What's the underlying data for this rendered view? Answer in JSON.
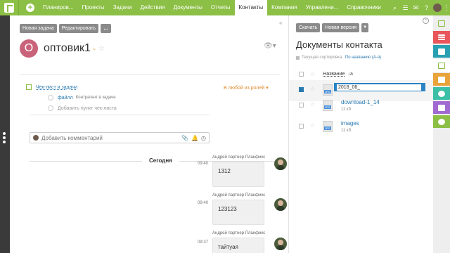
{
  "topbar": {
    "nav": [
      "Планиров...",
      "Проекты",
      "Задачи",
      "Действия",
      "Документы",
      "Отчеты",
      "Контакты",
      "Компания",
      "Управлени...",
      "Справочники"
    ],
    "active_index": 6
  },
  "toolbar": {
    "new_task": "Новая задача",
    "edit": "Редактировать",
    "more": "..."
  },
  "contact": {
    "initial": "О",
    "name": "оптовик1",
    "dash": "-"
  },
  "checklist": {
    "title": "Чек-лист и задачи",
    "roles": "В любой из ролей ▾",
    "item_link": "файлл",
    "item_sub": "Контрагент в задаче",
    "add_item": "Добавить пункт чек-листа"
  },
  "comment": {
    "placeholder": "Добавить комментарий"
  },
  "timeline": {
    "today": "Сегодня",
    "messages": [
      {
        "author": "Андрей партнер Планфикс",
        "time": "09:40",
        "text": "1312"
      },
      {
        "author": "Андрей партнер Планфикс",
        "time": "09:40",
        "text": "123123"
      },
      {
        "author": "Андрей партнер Планфикс",
        "time": "09:37",
        "text": "тайтуая"
      }
    ]
  },
  "panel": {
    "download": "Скачать",
    "new_version": "Новая версия",
    "title": "Документы контакта",
    "sort_label": "Текущая сортировка:",
    "sort_value": "По названию (А-я)",
    "col_name": "Название",
    "col_sort_icon": "↓a",
    "files": [
      {
        "name": "2018_06_",
        "size": "",
        "ext": "JPG",
        "selected": true
      },
      {
        "name": "download-1_14",
        "size": "11 кб",
        "ext": "JPG",
        "selected": false
      },
      {
        "name": "images",
        "size": "11 кб",
        "ext": "JPG",
        "selected": false
      }
    ]
  },
  "rail_colors": [
    "#8cbf45",
    "#e8555a",
    "#29a0b1",
    "#e0e0e0",
    "#e8a33a",
    "#3bbfa6",
    "#a06ad0",
    "#8cbf45"
  ]
}
